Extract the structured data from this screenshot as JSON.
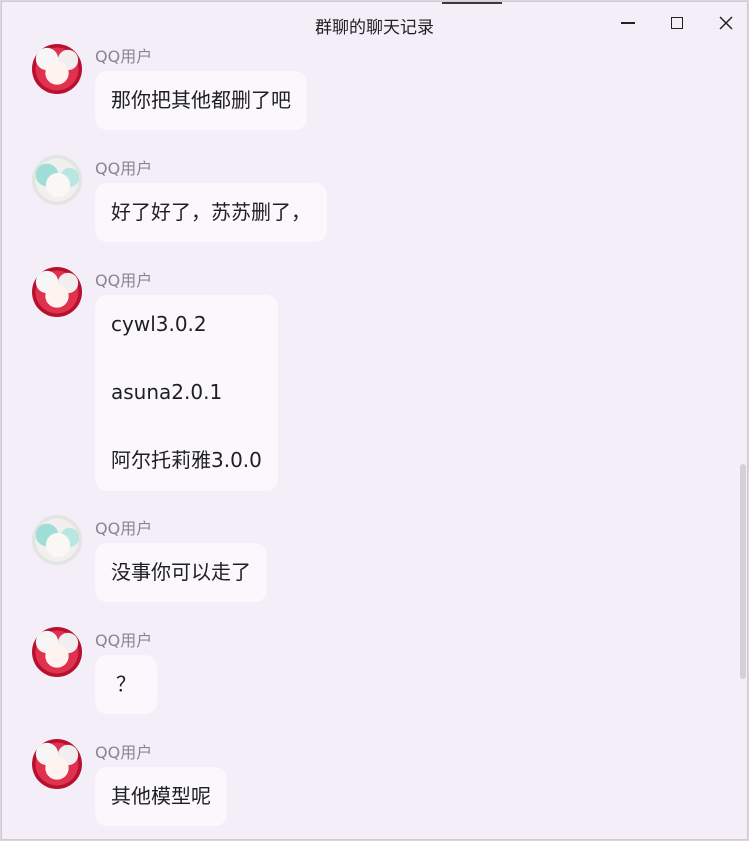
{
  "window": {
    "title": "群聊的聊天记录"
  },
  "messages": [
    {
      "sender": "QQ用户",
      "avatar": "red",
      "lines": [
        "那你把其他都删了吧"
      ]
    },
    {
      "sender": "QQ用户",
      "avatar": "teal",
      "lines": [
        "好了好了，苏苏删了，"
      ]
    },
    {
      "sender": "QQ用户",
      "avatar": "red",
      "lines": [
        "cywl3.0.2",
        "asuna2.0.1",
        "阿尔托莉雅3.0.0"
      ]
    },
    {
      "sender": "QQ用户",
      "avatar": "teal",
      "lines": [
        "没事你可以走了"
      ]
    },
    {
      "sender": "QQ用户",
      "avatar": "red",
      "lines": [
        "？"
      ]
    },
    {
      "sender": "QQ用户",
      "avatar": "red",
      "lines": [
        "其他模型呢"
      ]
    }
  ]
}
